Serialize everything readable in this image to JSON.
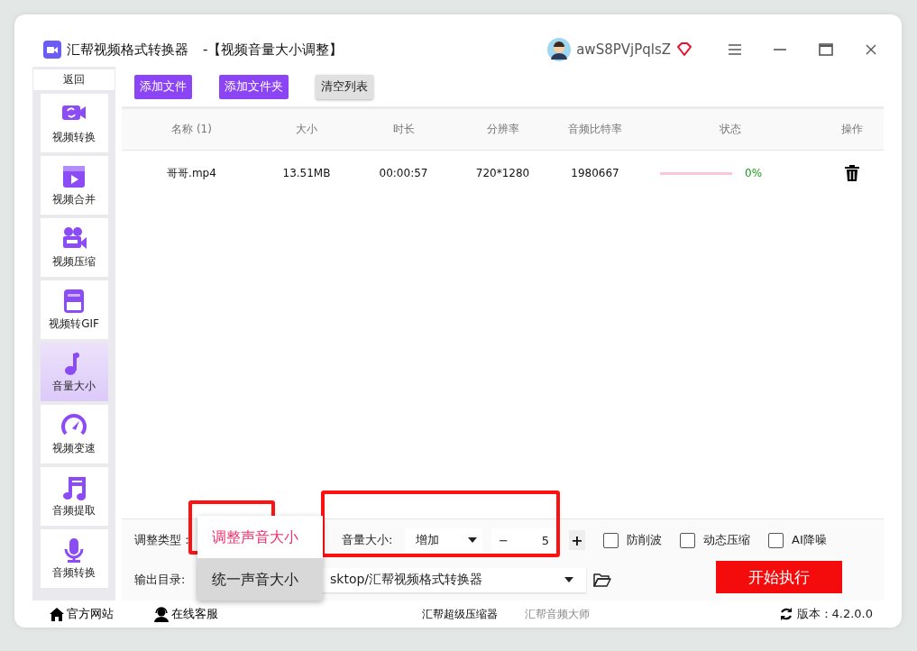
{
  "window": {
    "app_name": "汇帮视频格式转换器",
    "subtitle": "-【视频音量大小调整】",
    "username": "awS8PVjPqlsZ"
  },
  "sidebar": {
    "back": "返回",
    "items": [
      {
        "label": "视频转换",
        "selected": false
      },
      {
        "label": "视频合并",
        "selected": false
      },
      {
        "label": "视频压缩",
        "selected": false
      },
      {
        "label": "视频转GIF",
        "selected": false
      },
      {
        "label": "音量大小",
        "selected": true
      },
      {
        "label": "视频变速",
        "selected": false
      },
      {
        "label": "音频提取",
        "selected": false
      },
      {
        "label": "音频转换",
        "selected": false
      }
    ]
  },
  "toolbar": {
    "buttons": [
      {
        "label": "添加文件",
        "kind": "primary"
      },
      {
        "label": "添加文件夹",
        "kind": "primary"
      },
      {
        "label": "清空列表",
        "kind": "secondary"
      }
    ]
  },
  "table": {
    "columns": [
      "名称 (1)",
      "大小",
      "时长",
      "分辨率",
      "音频比特率",
      "状态",
      "操作"
    ],
    "rows": [
      {
        "name": "哥哥.mp4",
        "size": "13.51MB",
        "duration": "00:00:57",
        "resolution": "720*1280",
        "bitrate": "1980667",
        "level": 0,
        "progress": "0%"
      }
    ]
  },
  "settings": {
    "type_label": "调整类型：",
    "volume_label": "音量大小:",
    "mode": "增加",
    "amount": "5",
    "minus": "−",
    "plus": "+",
    "checkboxes": [
      {
        "label": "防削波",
        "checked": false
      },
      {
        "label": "动态压缩",
        "checked": false
      },
      {
        "label": "AI降噪",
        "checked": false
      }
    ],
    "output_label": "输出目录:",
    "output_path": "sktop/汇帮视频格式转换器",
    "start": "开始执行"
  },
  "dropdown_menu": [
    {
      "label": "调整声音大小",
      "selected": true,
      "hovered": false
    },
    {
      "label": "统一声音大小",
      "selected": false,
      "hovered": true
    }
  ],
  "footer": {
    "links": [
      {
        "label": "官方网站"
      },
      {
        "label": "在线客服"
      }
    ],
    "products": [
      {
        "label": "汇帮超级压缩器",
        "kind": "strong"
      },
      {
        "label": "汇帮音频大师",
        "kind": "muted"
      }
    ],
    "version": "版本：4.2.0.0"
  },
  "annotations": [
    {
      "kind": "frame"
    },
    {
      "kind": "frame"
    }
  ]
}
